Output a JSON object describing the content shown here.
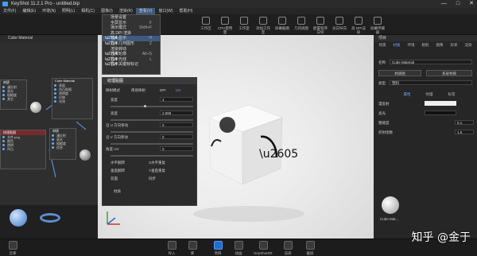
{
  "window": {
    "title": "KeyShot 11.2.1 Pro  -  untitled.bip",
    "controls": [
      "—",
      "□",
      "✕"
    ]
  },
  "menu": [
    "文件(F)",
    "编辑(E)",
    "环境(N)",
    "照明(L)",
    "相机(C)",
    "图像(I)",
    "渲染(R)",
    "查看(V)",
    "窗口(W)",
    "帮助(H)"
  ],
  "toolbar": {
    "items": [
      "工作区",
      "CPU使用量",
      "暂停",
      "性能模式",
      "工作室",
      "添加工作室",
      "屏幕截图",
      "几何视图",
      "配置程序向导",
      "光向导向",
      "高 DPI渲染",
      "屏幕传输器"
    ],
    "ratio_label": "几何图形视图"
  },
  "dropdown": {
    "items": [
      {
        "label": "场景设置",
        "shortcut": "",
        "check": false
      },
      {
        "label": "全屏显示",
        "shortcut": "F",
        "check": false
      },
      {
        "label": "演示模式",
        "shortcut": "Shift+F",
        "check": false
      },
      {
        "label": "高 DPI 渲染",
        "shortcut": "",
        "check": false
      },
      {
        "label": "轴头显示",
        "shortcut": "H",
        "check": true,
        "highlight": true
      },
      {
        "label": "显示几何图形",
        "shortcut": "Z",
        "check": true
      },
      {
        "label": "渲染转动",
        "shortcut": "",
        "check": false
      },
      {
        "label": "选择轮廓",
        "shortcut": "Alt+S",
        "check": true
      },
      {
        "label": "显示光线",
        "shortcut": "L",
        "check": true
      },
      {
        "label": "显示关键帧标记",
        "shortcut": "",
        "check": true
      }
    ]
  },
  "left": {
    "header": "项目",
    "search_value": "Cube Material",
    "nodes": [
      {
        "title": "Cube Material",
        "ports": [
          "表面",
          "凹凸贴图",
          "透明度",
          "位移",
          "光线"
        ]
      },
      {
        "title": "材质",
        "ports": [
          "漫反射",
          "高光",
          "粗糙度",
          "其它"
        ]
      },
      {
        "title": "纹理贴图",
        "ports": [
          "文件.png",
          "颜色",
          "透明",
          "凹凸"
        ]
      },
      {
        "title": "材质",
        "ports": [
          "漫反射",
          "高光",
          "粗糙度",
          "信息"
        ]
      }
    ],
    "lib_label": "云库"
  },
  "props": {
    "title": "纹理贴图",
    "mode_label": "映射模式",
    "modes": [
      "简易映射",
      "DPI",
      "UV"
    ],
    "rows": [
      {
        "label": "宽度",
        "value": "4"
      },
      {
        "label": "高度",
        "value": "2.899"
      },
      {
        "label": "沿 U 方向移动",
        "value": "0"
      },
      {
        "label": "沿 V 方向移动",
        "value": "0"
      },
      {
        "label": "角度 UV",
        "value": "0"
      }
    ],
    "checks": [
      "水平翻转",
      "X水平重复",
      "垂直翻转",
      "Y垂直重复",
      "双面",
      "同步"
    ],
    "footer": "材质"
  },
  "right": {
    "header": "项目",
    "tabs": [
      "场景",
      "材质",
      "环境",
      "相机",
      "图像",
      "形状",
      "渲染"
    ],
    "name_label": "名称",
    "material_name": "Cube Material",
    "btn1": "材质图",
    "btn2": "多层材质",
    "type_label": "类型",
    "type_value": "塑料",
    "subtabs": [
      "属性",
      "纹理",
      "标签"
    ],
    "rows": [
      {
        "label": "漫反射",
        "value": ""
      },
      {
        "label": "高光",
        "value": ""
      },
      {
        "label": "粗糙度",
        "value": "0.1"
      },
      {
        "label": "折射指数",
        "value": "1.5"
      }
    ],
    "thumb_label": "Cube Mat..."
  },
  "bottom": {
    "items": [
      "导入",
      "库",
      "项目",
      "动画",
      "KeyShotXR",
      "渲染",
      "截屏"
    ],
    "left_item": "云库"
  },
  "watermark": "知乎 @金于"
}
